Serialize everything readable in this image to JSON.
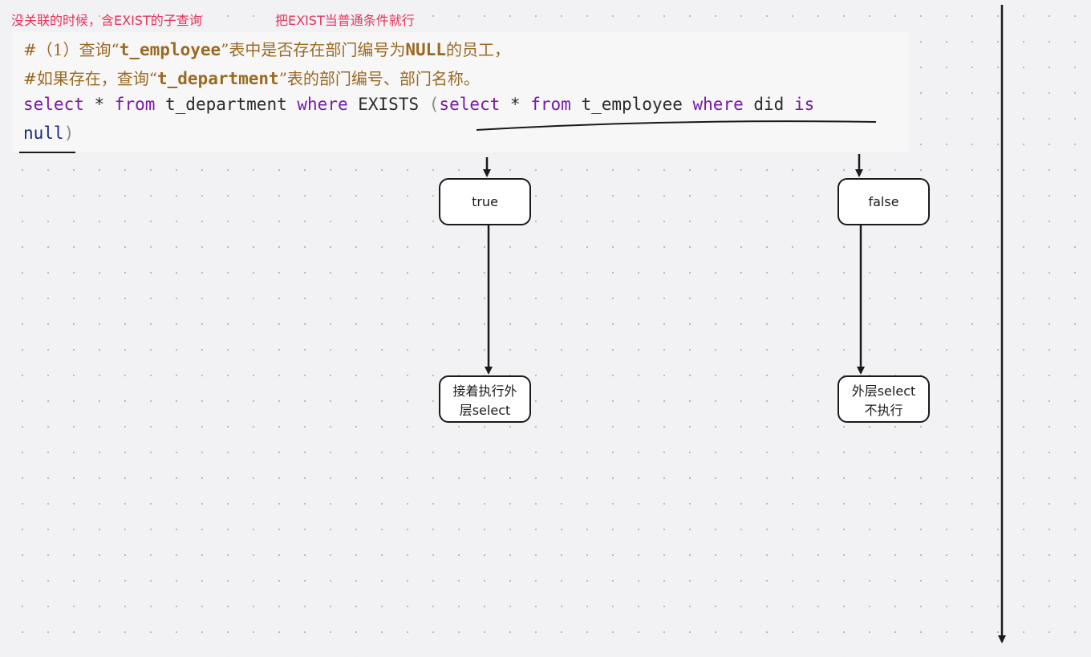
{
  "notes": {
    "left": "没关联的时候，含EXIST的子查询",
    "right": "把EXIST当普通条件就行"
  },
  "code": {
    "line1": {
      "a": "#（1）查询“",
      "b": "t_employee",
      "c": "”表中是否存在部门编号为",
      "d": "NULL",
      "e": "的员工，"
    },
    "line2": {
      "a": "#如果存在，查询“",
      "b": "t_department",
      "c": "”表的部门编号、部门名称。"
    },
    "line3": {
      "t1": "select",
      "t2": " * ",
      "t3": "from",
      "t4": " t_department ",
      "t5": "where",
      "t6": " EXISTS ",
      "t7": "(",
      "t8": "select",
      "t9": " * ",
      "t10": "from",
      "t11": " t_employee ",
      "t12": "where",
      "t13": " did ",
      "t14": "is"
    },
    "line4": {
      "t1": "null",
      "t2": ")"
    }
  },
  "nodes": {
    "true_label": "true",
    "false_label": "false",
    "true_result": "接着执行外层select",
    "false_result": "外层select不执行"
  },
  "colors": {
    "note": "#e8335a",
    "keyword": "#7a1aa6",
    "comment": "#9b6a22",
    "literal": "#1a2a80",
    "stroke": "#1a1a1a"
  }
}
